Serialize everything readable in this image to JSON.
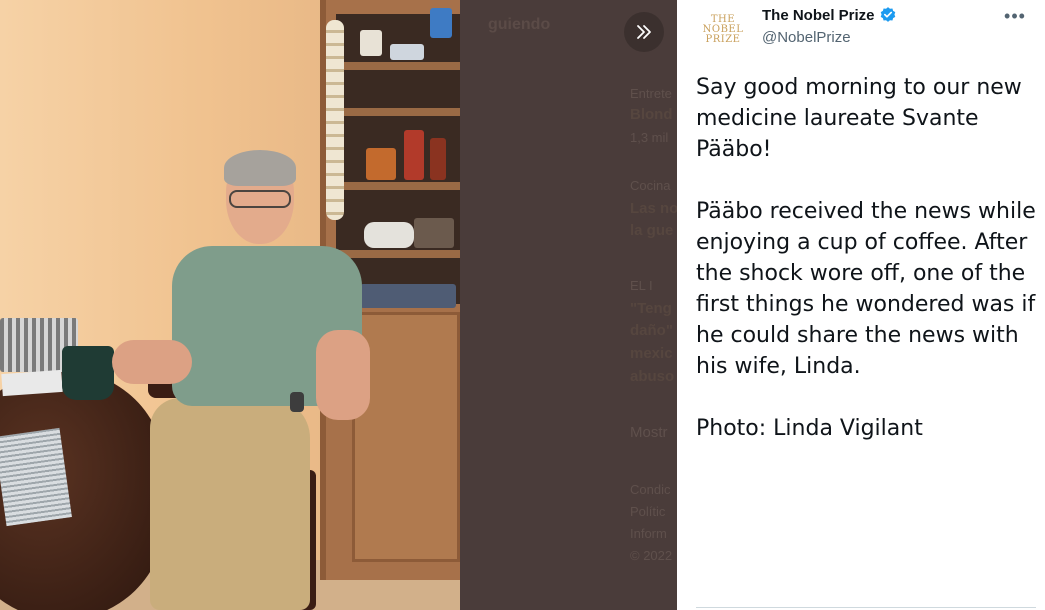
{
  "background_page": {
    "follow_label_partial": "guiendo",
    "items": [
      {
        "kicker": "Entrete",
        "title": "Blond",
        "meta": "1,3 mil"
      },
      {
        "kicker": "Cocina",
        "title": "Las no",
        "title2": "la gue"
      },
      {
        "kicker": "EL I",
        "title": "\"Teng",
        "title2": "daño\"",
        "title3": "mexic",
        "title4": "abuso"
      }
    ],
    "show_more_partial": "Mostr",
    "footer": [
      "Condic",
      "Polític",
      "Inform",
      "© 2022"
    ]
  },
  "expand_button": {
    "icon": "double-chevron-right-icon"
  },
  "tweet": {
    "author": {
      "avatar_lines": [
        "THE",
        "NOBEL",
        "PRIZE"
      ],
      "name": "The Nobel Prize",
      "handle": "@NobelPrize",
      "verified": true
    },
    "more_icon": "•••",
    "paragraphs": [
      "Say good morning to our new medicine laureate Svante Pääbo!",
      "Pääbo received the news while enjoying a cup of coffee. After the shock wore off, one of the first things he wondered was if he could share the news with his wife, Linda.",
      "Photo: Linda Vigilant"
    ]
  },
  "colors": {
    "panel_bg": "#ffffff",
    "backdrop": "#4a3c3a",
    "verified_blue": "#1d9bf0",
    "text": "#0f1419",
    "muted": "#536471"
  }
}
